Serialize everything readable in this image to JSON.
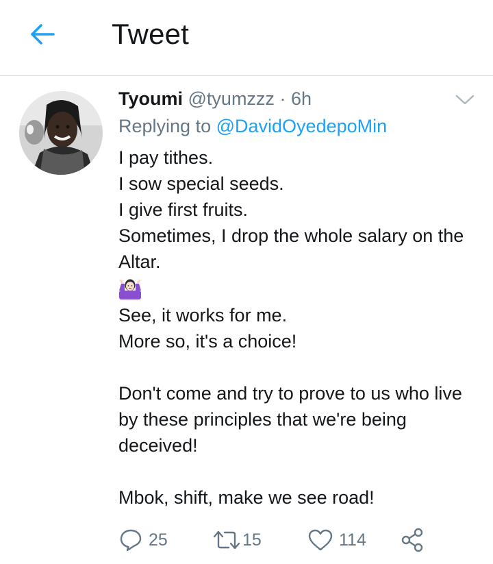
{
  "header": {
    "title": "Tweet",
    "back_icon": "arrow-left-icon",
    "accent_color": "#1da1f2"
  },
  "tweet": {
    "display_name": "Tyoumi",
    "handle": "@tyumzzz",
    "separator": "·",
    "time": "6h",
    "reply_prefix": "Replying to",
    "reply_mention": "@DavidOyedepoMin",
    "lines": [
      "I pay tithes.",
      "I sow special seeds.",
      "I give first fruits.",
      "Sometimes, I drop the whole salary on the",
      "Altar.",
      "See, it works for me.",
      "More so, it's a choice!",
      "Don't come and try to prove to us who live",
      "by these principles that we're being",
      "deceived!",
      "Mbok, shift, make we see road!"
    ],
    "emoji": "person-shrugging-emoji"
  },
  "actions": {
    "reply_count": "25",
    "retweet_count": "15",
    "like_count": "114",
    "reply_icon": "reply-icon",
    "retweet_icon": "retweet-icon",
    "like_icon": "heart-icon",
    "share_icon": "share-icon"
  }
}
